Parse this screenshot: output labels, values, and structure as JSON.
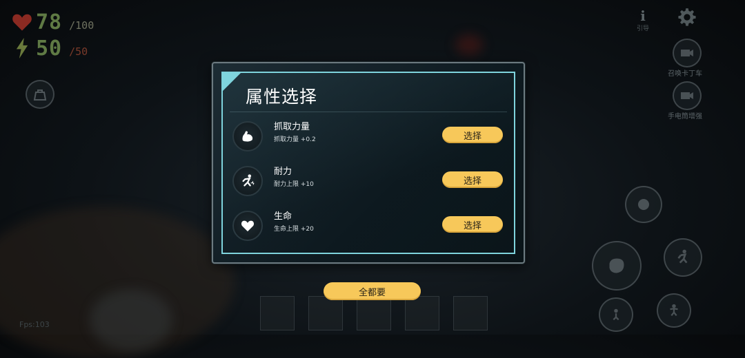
{
  "hud": {
    "health_value": "78",
    "health_max": "/100",
    "stamina_value": "50",
    "stamina_max": "/50",
    "fps_label": "Fps:103"
  },
  "top_right": {
    "guide_label": "引导",
    "side_item_1_label": "召唤卡丁车",
    "side_item_2_label": "手电筒增强"
  },
  "dialog": {
    "title": "属性选择",
    "options": [
      {
        "name": "抓取力量",
        "desc": "抓取力量 +0.2",
        "button": "选择",
        "icon": "flexed-arm-icon"
      },
      {
        "name": "耐力",
        "desc": "耐力上限 +10",
        "button": "选择",
        "icon": "running-person-icon"
      },
      {
        "name": "生命",
        "desc": "生命上限 +20",
        "button": "选择",
        "icon": "heart-icon"
      }
    ],
    "take_all_button": "全都要"
  },
  "colors": {
    "accent_yellow": "#f7c85a",
    "frame_cyan": "#7fd4dd",
    "hud_green": "#5f7a44",
    "heart_red": "#8b2a22"
  }
}
